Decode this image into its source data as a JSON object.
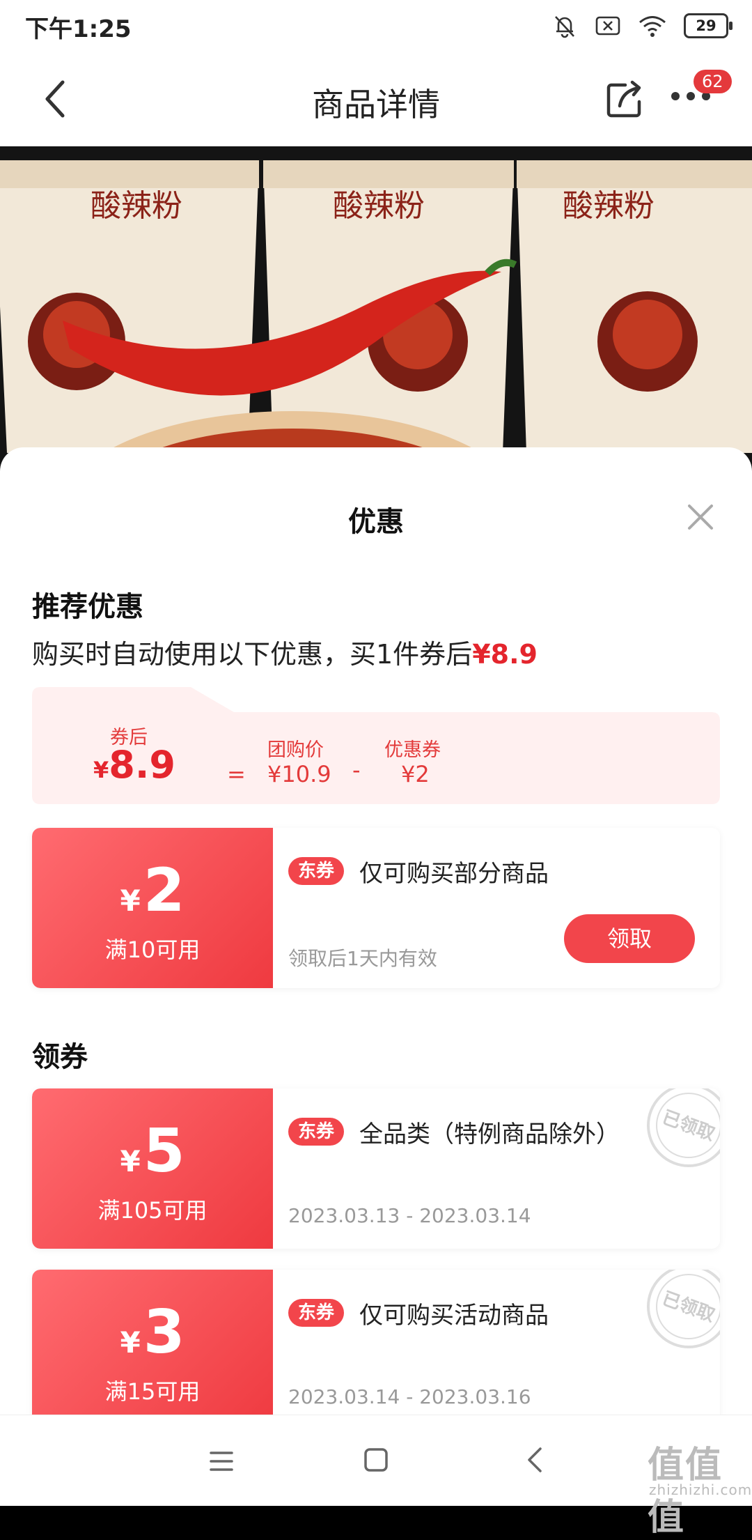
{
  "status_bar": {
    "time": "下午1:25",
    "battery": "29"
  },
  "nav": {
    "title": "商品详情",
    "badge_count": "62"
  },
  "product": {
    "text": "酸辣粉"
  },
  "sheet": {
    "title": "优惠",
    "recommend": {
      "heading": "推荐优惠",
      "desc_prefix": "购买时自动使用以下优惠，买1件券后",
      "desc_price": "¥8.9",
      "after_label": "券后",
      "after_price": "8.9",
      "yen": "¥",
      "equals": "=",
      "group_label": "团购价",
      "group_price": "¥10.9",
      "minus": "-",
      "coupon_label": "优惠券",
      "coupon_price": "¥2"
    },
    "featured_coupon": {
      "amount": "2",
      "condition": "满10可用",
      "tag": "东券",
      "description": "仅可购买部分商品",
      "validity": "领取后1天内有效",
      "button": "领取"
    },
    "coupons_heading": "领券",
    "coupons": [
      {
        "amount": "5",
        "condition": "满105可用",
        "tag": "东券",
        "description": "全品类（特例商品除外）",
        "date": "2023.03.13 - 2023.03.14",
        "stamp": "已领取"
      },
      {
        "amount": "3",
        "condition": "满15可用",
        "tag": "东券",
        "description": "仅可购买活动商品",
        "date": "2023.03.14 - 2023.03.16",
        "stamp": "已领取"
      }
    ]
  },
  "watermark": {
    "main": "值值值",
    "sub": "zhizhizhi.com"
  },
  "colors": {
    "accent": "#e4252d",
    "coupon": "#f2454b",
    "calc_bg": "#fff0f0"
  }
}
